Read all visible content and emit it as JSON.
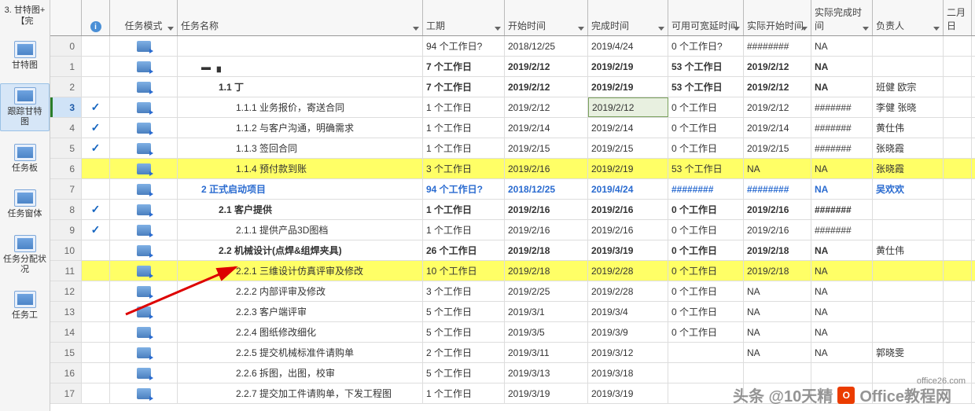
{
  "sidebar": {
    "top_label": "3. 甘特图+【完",
    "items": [
      {
        "label": "甘特图"
      },
      {
        "label": "跟踪甘特图"
      },
      {
        "label": "任务板"
      },
      {
        "label": "任务窗体"
      },
      {
        "label": "任务分配状况"
      },
      {
        "label": "任务工"
      }
    ]
  },
  "columns": {
    "id": "",
    "info": "ℹ",
    "mode": "任务模式",
    "name": "任务名称",
    "duration": "工期",
    "start": "开始时间",
    "finish": "完成时间",
    "slack": "可用可宽延时间",
    "astart": "实际开始时间",
    "afinish": "实际完成时间",
    "owner": "负责人",
    "feb": "二月日"
  },
  "rows": [
    {
      "id": "0",
      "check": false,
      "name": "",
      "indent": 0,
      "dur": "94 个工作日?",
      "start": "2018/12/25",
      "finish": "2019/4/24",
      "slack": "0 个工作日?",
      "astart": "########",
      "afinish": "NA",
      "owner": "",
      "yellow": false
    },
    {
      "id": "1",
      "check": false,
      "name": "▬  ▗",
      "indent": 1,
      "dur": "7 个工作日",
      "start": "2019/2/12",
      "finish": "2019/2/19",
      "slack": "53 个工作日",
      "astart": "2019/2/12",
      "afinish": "NA",
      "owner": "",
      "yellow": false,
      "bold": true
    },
    {
      "id": "2",
      "check": false,
      "name": "1.1 丁",
      "indent": 2,
      "dur": "7 个工作日",
      "start": "2019/2/12",
      "finish": "2019/2/19",
      "slack": "53 个工作日",
      "astart": "2019/2/12",
      "afinish": "NA",
      "owner": "班健 欧宗",
      "yellow": false,
      "bold": true
    },
    {
      "id": "3",
      "check": true,
      "name": "1.1.1 业务报价，寄送合同",
      "indent": 3,
      "dur": "1 个工作日",
      "start": "2019/2/12",
      "finish": "2019/2/12",
      "slack": "0 个工作日",
      "astart": "2019/2/12",
      "afinish": "#######",
      "owner": "李健 张晓",
      "yellow": false,
      "sel": true,
      "hlf": true
    },
    {
      "id": "4",
      "check": true,
      "name": "1.1.2 与客户沟通，明确需求",
      "indent": 3,
      "dur": "1 个工作日",
      "start": "2019/2/14",
      "finish": "2019/2/14",
      "slack": "0 个工作日",
      "astart": "2019/2/14",
      "afinish": "#######",
      "owner": "黄仕伟",
      "yellow": false
    },
    {
      "id": "5",
      "check": true,
      "name": "1.1.3 签回合同",
      "indent": 3,
      "dur": "1 个工作日",
      "start": "2019/2/15",
      "finish": "2019/2/15",
      "slack": "0 个工作日",
      "astart": "2019/2/15",
      "afinish": "#######",
      "owner": "张晓霞",
      "yellow": false
    },
    {
      "id": "6",
      "check": false,
      "name": "1.1.4 预付款到账",
      "indent": 3,
      "dur": "3 个工作日",
      "start": "2019/2/16",
      "finish": "2019/2/19",
      "slack": "53 个工作日",
      "astart": "NA",
      "afinish": "NA",
      "owner": "张晓霞",
      "yellow": true
    },
    {
      "id": "7",
      "check": false,
      "name": "2 正式启动项目",
      "indent": 1,
      "dur": "94 个工作日?",
      "start": "2018/12/25",
      "finish": "2019/4/24",
      "slack": "########",
      "astart": "########",
      "afinish": "NA",
      "owner": "吴欢欢",
      "yellow": false,
      "blue": true,
      "bold": true
    },
    {
      "id": "8",
      "check": true,
      "name": "2.1 客户提供",
      "indent": 2,
      "dur": "1 个工作日",
      "start": "2019/2/16",
      "finish": "2019/2/16",
      "slack": "0 个工作日",
      "astart": "2019/2/16",
      "afinish": "#######",
      "owner": "",
      "yellow": false,
      "bold": true
    },
    {
      "id": "9",
      "check": true,
      "name": "2.1.1 提供产品3D图档",
      "indent": 3,
      "dur": "1 个工作日",
      "start": "2019/2/16",
      "finish": "2019/2/16",
      "slack": "0 个工作日",
      "astart": "2019/2/16",
      "afinish": "#######",
      "owner": "",
      "yellow": false
    },
    {
      "id": "10",
      "check": false,
      "name": "2.2 机械设计(点焊&组焊夹具)",
      "indent": 2,
      "dur": "26 个工作日",
      "start": "2019/2/18",
      "finish": "2019/3/19",
      "slack": "0 个工作日",
      "astart": "2019/2/18",
      "afinish": "NA",
      "owner": "黄仕伟",
      "yellow": false,
      "bold": true
    },
    {
      "id": "11",
      "check": false,
      "name": "2.2.1 三维设计仿真评审及修改",
      "indent": 3,
      "dur": "10 个工作日",
      "start": "2019/2/18",
      "finish": "2019/2/28",
      "slack": "0 个工作日",
      "astart": "2019/2/18",
      "afinish": "NA",
      "owner": "",
      "yellow": true
    },
    {
      "id": "12",
      "check": false,
      "name": "2.2.2 内部评审及修改",
      "indent": 3,
      "dur": "3 个工作日",
      "start": "2019/2/25",
      "finish": "2019/2/28",
      "slack": "0 个工作日",
      "astart": "NA",
      "afinish": "NA",
      "owner": "",
      "yellow": false
    },
    {
      "id": "13",
      "check": false,
      "name": "2.2.3 客户端评审",
      "indent": 3,
      "dur": "5 个工作日",
      "start": "2019/3/1",
      "finish": "2019/3/4",
      "slack": "0 个工作日",
      "astart": "NA",
      "afinish": "NA",
      "owner": "",
      "yellow": false
    },
    {
      "id": "14",
      "check": false,
      "name": "2.2.4 图纸修改细化",
      "indent": 3,
      "dur": "5 个工作日",
      "start": "2019/3/5",
      "finish": "2019/3/9",
      "slack": "0 个工作日",
      "astart": "NA",
      "afinish": "NA",
      "owner": "",
      "yellow": false
    },
    {
      "id": "15",
      "check": false,
      "name": "2.2.5 提交机械标准件请购单",
      "indent": 3,
      "dur": "2 个工作日",
      "start": "2019/3/11",
      "finish": "2019/3/12",
      "slack": "",
      "astart": "NA",
      "afinish": "NA",
      "owner": "郭晓雯",
      "yellow": false
    },
    {
      "id": "16",
      "check": false,
      "name": "2.2.6 拆图，出图，校审",
      "indent": 3,
      "dur": "5 个工作日",
      "start": "2019/3/13",
      "finish": "2019/3/18",
      "slack": "",
      "astart": "",
      "afinish": "",
      "owner": "",
      "yellow": false
    },
    {
      "id": "17",
      "check": false,
      "name": "2.2.7 提交加工件请购单，下发工程图",
      "indent": 3,
      "dur": "1 个工作日",
      "start": "2019/3/19",
      "finish": "2019/3/19",
      "slack": "",
      "astart": "",
      "afinish": "",
      "owner": "",
      "yellow": false
    }
  ],
  "watermark": {
    "text1": "头条 @10天精",
    "text2": "Office教程网"
  },
  "tag": "office26.com"
}
